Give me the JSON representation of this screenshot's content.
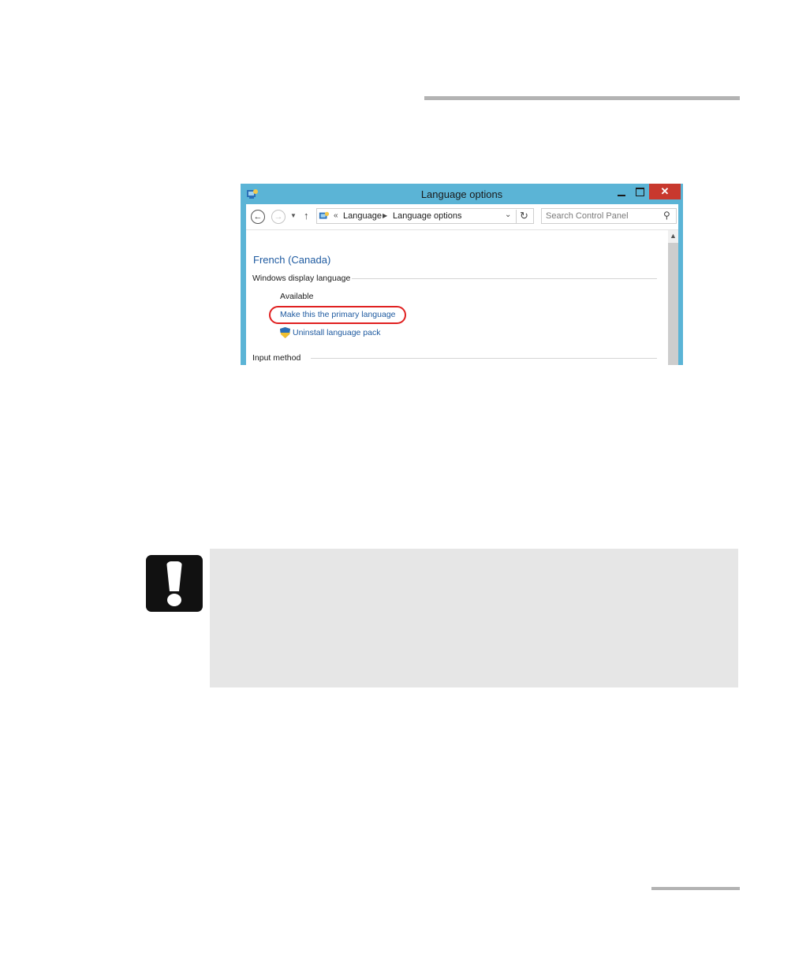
{
  "window": {
    "title": "Language options",
    "close_glyph": "✕",
    "nav": {
      "back_glyph": "←",
      "forward_glyph": "→",
      "up_glyph": "↑",
      "address_prefix": "«",
      "address_crumbs": [
        "Language",
        "Language options"
      ],
      "refresh_glyph": "↻",
      "search_placeholder": "Search Control Panel"
    },
    "content": {
      "heading": "French (Canada)",
      "display_section": "Windows display language",
      "status": "Available",
      "primary_link": "Make this the primary language",
      "uninstall_link": "Uninstall language pack",
      "input_section": "Input method"
    },
    "highlight_color": "#e02020"
  },
  "icons": [
    "control-panel-icon",
    "shield-icon",
    "important-icon",
    "search-icon"
  ]
}
